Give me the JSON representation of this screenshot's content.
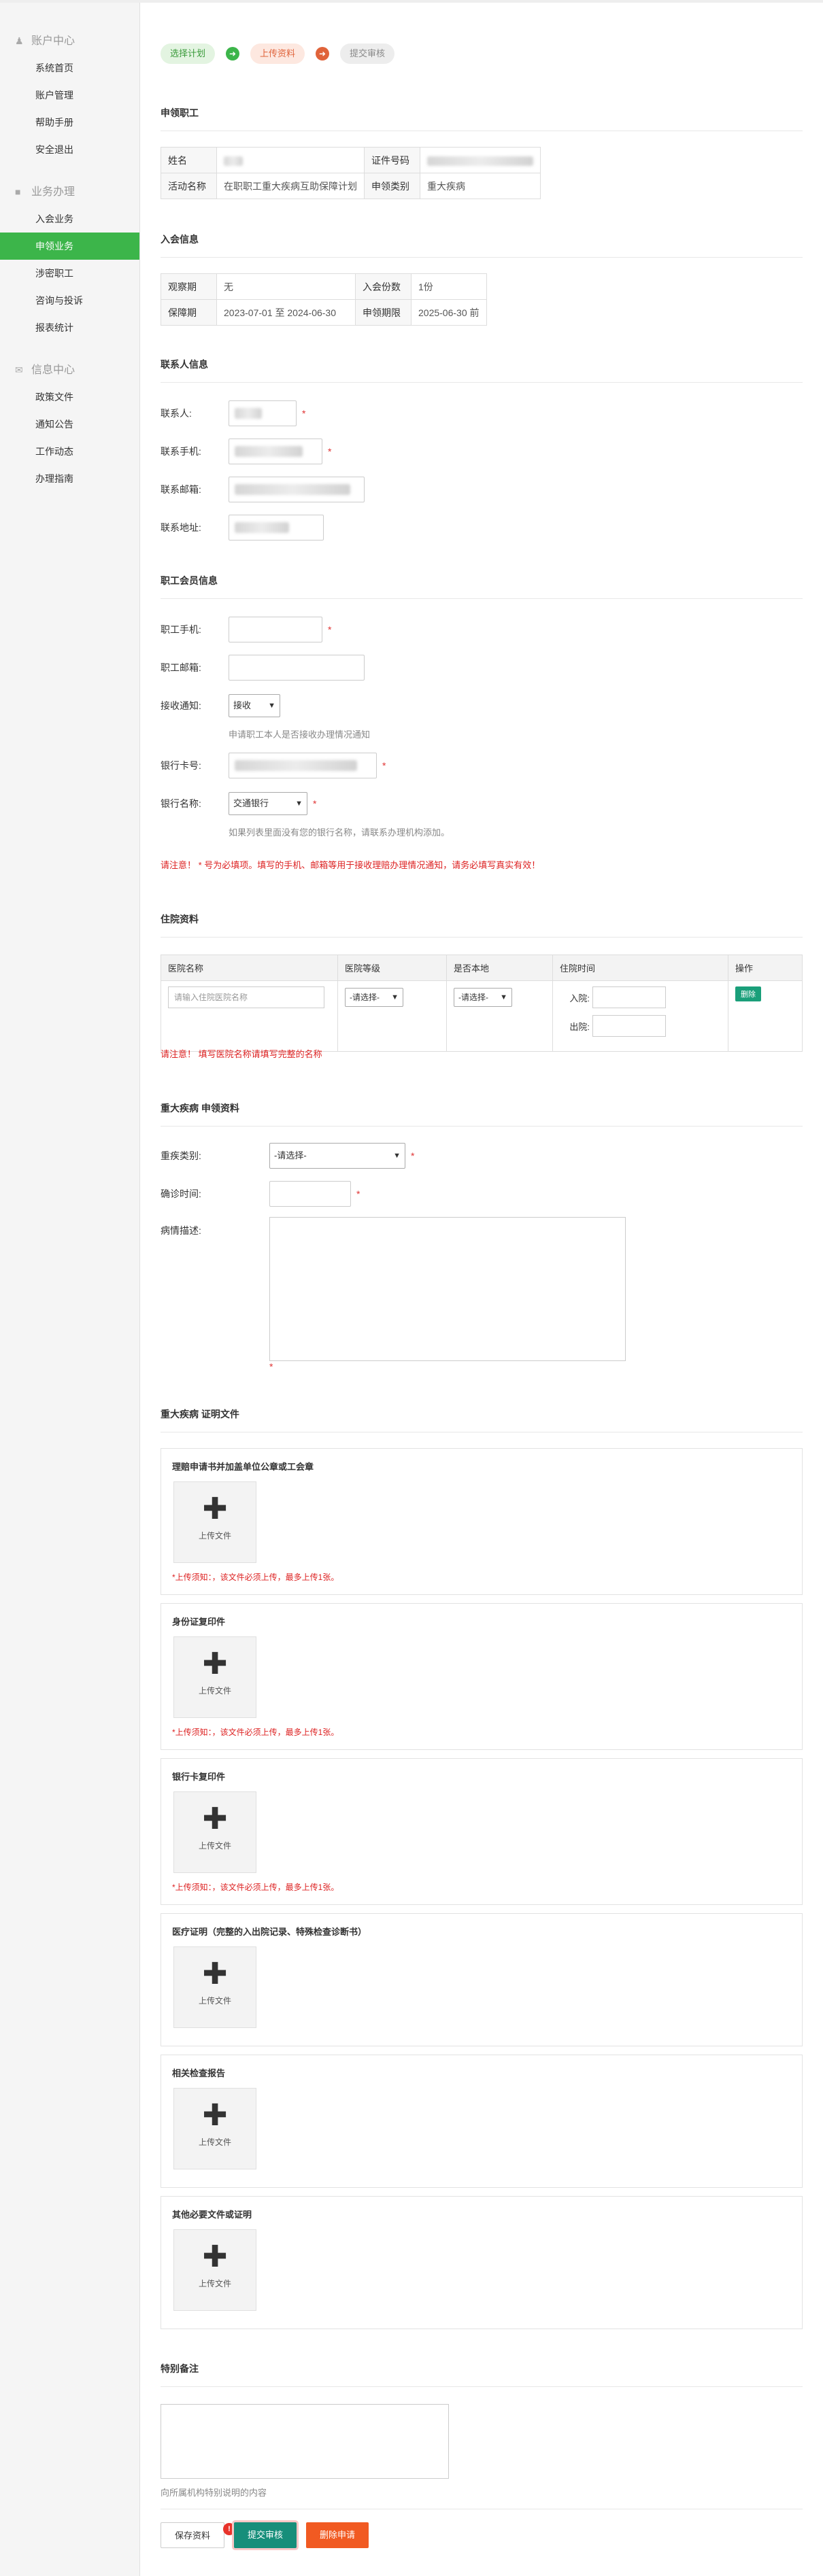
{
  "sidebar": {
    "groups": [
      {
        "title": "账户中心",
        "icon": "user-icon",
        "items": [
          "系统首页",
          "账户管理",
          "帮助手册",
          "安全退出"
        ]
      },
      {
        "title": "业务办理",
        "icon": "briefcase-icon",
        "items": [
          "入会业务",
          "申领业务",
          "涉密职工",
          "咨询与投诉",
          "报表统计"
        ]
      },
      {
        "title": "信息中心",
        "icon": "envelope-icon",
        "items": [
          "政策文件",
          "通知公告",
          "工作动态",
          "办理指南"
        ]
      }
    ],
    "active_item": "申领业务"
  },
  "steps": [
    "选择计划",
    "上传资料",
    "提交审核"
  ],
  "applicant": {
    "section_title": "申领职工",
    "name_label": "姓名",
    "id_label": "证件号码",
    "activity_label": "活动名称",
    "activity_value": "在职职工重大疾病互助保障计划",
    "category_label": "申领类别",
    "category_value": "重大疾病"
  },
  "membership": {
    "section_title": "入会信息",
    "obs_label": "观察期",
    "obs_value": "无",
    "shares_label": "入会份数",
    "shares_value": "1份",
    "period_label": "保障期",
    "period_value": "2023-07-01 至 2024-06-30",
    "deadline_label": "申领期限",
    "deadline_value": "2025-06-30 前"
  },
  "contact": {
    "section_title": "联系人信息",
    "person_label": "联系人:",
    "phone_label": "联系手机:",
    "email_label": "联系邮箱:",
    "address_label": "联系地址:",
    "required_mark": "*"
  },
  "member": {
    "section_title": "职工会员信息",
    "phone_label": "职工手机:",
    "email_label": "职工邮箱:",
    "notice_label": "接收通知:",
    "notice_value": "接收",
    "notice_hint": "申请职工本人是否接收办理情况通知",
    "bank_card_label": "银行卡号:",
    "bank_name_label": "银行名称:",
    "bank_name_value": "交通银行",
    "bank_hint": "如果列表里面没有您的银行名称，请联系办理机构添加。",
    "warning": "请注意！ * 号为必填项。填写的手机、邮箱等用于接收理赔办理情况通知，请务必填写真实有效！"
  },
  "hospital": {
    "section_title": "住院资料",
    "columns": [
      "医院名称",
      "医院等级",
      "是否本地",
      "住院时间",
      "操作"
    ],
    "name_placeholder": "请输入住院医院名称",
    "level_select": "-请选择-",
    "local_select": "-请选择-",
    "admit_label": "入院:",
    "discharge_label": "出院:",
    "delete_label": "删除",
    "warning": "请注意！ 填写医院名称请填写完整的名称"
  },
  "disease": {
    "section_title": "重大疾病 申领资料",
    "type_label": "重疾类别:",
    "type_select": "-请选择-",
    "confirm_label": "确诊时间:",
    "desc_label": "病情描述:",
    "required_mark": "*"
  },
  "docs": {
    "section_title": "重大疾病 证明文件",
    "upload_label": "上传文件",
    "items": [
      {
        "title": "理赔申请书并加盖单位公章或工会章",
        "note": "*上传须知：，该文件必须上传，最多上传1张。"
      },
      {
        "title": "身份证复印件",
        "note": "*上传须知：，该文件必须上传，最多上传1张。"
      },
      {
        "title": "银行卡复印件",
        "note": "*上传须知：，该文件必须上传，最多上传1张。"
      },
      {
        "title": "医疗证明（完整的入出院记录、特殊检查诊断书）",
        "note": ""
      },
      {
        "title": "相关检查报告",
        "note": ""
      },
      {
        "title": "其他必要文件或证明",
        "note": ""
      }
    ]
  },
  "remarks": {
    "section_title": "特别备注",
    "hint": "向所属机构特别说明的内容"
  },
  "actions": {
    "save": "保存资料",
    "submit": "提交审核",
    "delete": "删除申请",
    "badge": "!"
  }
}
